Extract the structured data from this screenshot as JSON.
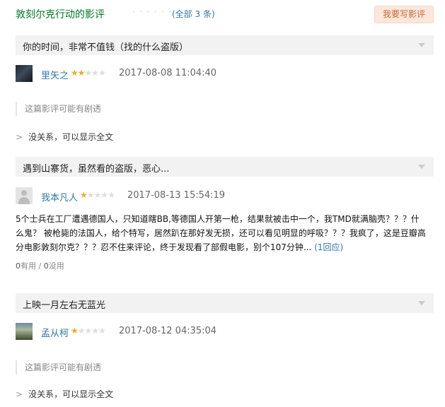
{
  "section": {
    "title": "敦刻尔克行动的影评",
    "dots": "· · · · · ·",
    "count": "(全部 3 条)",
    "write_button": "我要写影评"
  },
  "reviews": [
    {
      "title": "你的时间，非常不值钱（找的什么盗版）",
      "author": "里矢之",
      "rating": 2,
      "time": "2017-08-08 11:04:40",
      "spoiler_note": "这篇影评可能有剧透",
      "show_all": "没关系，可以显示全文"
    },
    {
      "title": "遇到山寨货，虽然看的盗版，恶心...",
      "author": "我本凡人",
      "rating": 1,
      "time": "2017-08-13 15:54:19",
      "body": "5个士兵在工厂遭遇德国人，只知道瞎BB,等德国人开第一枪，结果就被击中一个，我TMD就满脑壳？？？什么鬼？ 被枪毙的法国人，给个特写，居然趴在那好发无损，还可以看见明显的呼吸？？？我疯了，这是豆瓣高分电影敦刻尔克？？？忍不住来评论，终于发现看了部假电影，别个107分钟...",
      "more": "(1回应)",
      "useful_count": "0",
      "useful_label": "有用",
      "separator": " / ",
      "useless_count": "0",
      "useless_label": "没用"
    },
    {
      "title": "上映一月左右无蓝光",
      "author": "孟从柯",
      "rating": 1,
      "time": "2017-08-12 04:35:04",
      "spoiler_note": "这篇影评可能有剧透",
      "show_all": "没关系，可以显示全文"
    }
  ],
  "icons": {
    "star": "★",
    "chevron": ">",
    "fold": "chevron-down-icon"
  },
  "colors": {
    "title_green": "#007722",
    "link_blue": "#3377aa",
    "star_gold": "#f5a623",
    "button_bg": "#fbe7db",
    "button_text": "#cd6a31"
  }
}
